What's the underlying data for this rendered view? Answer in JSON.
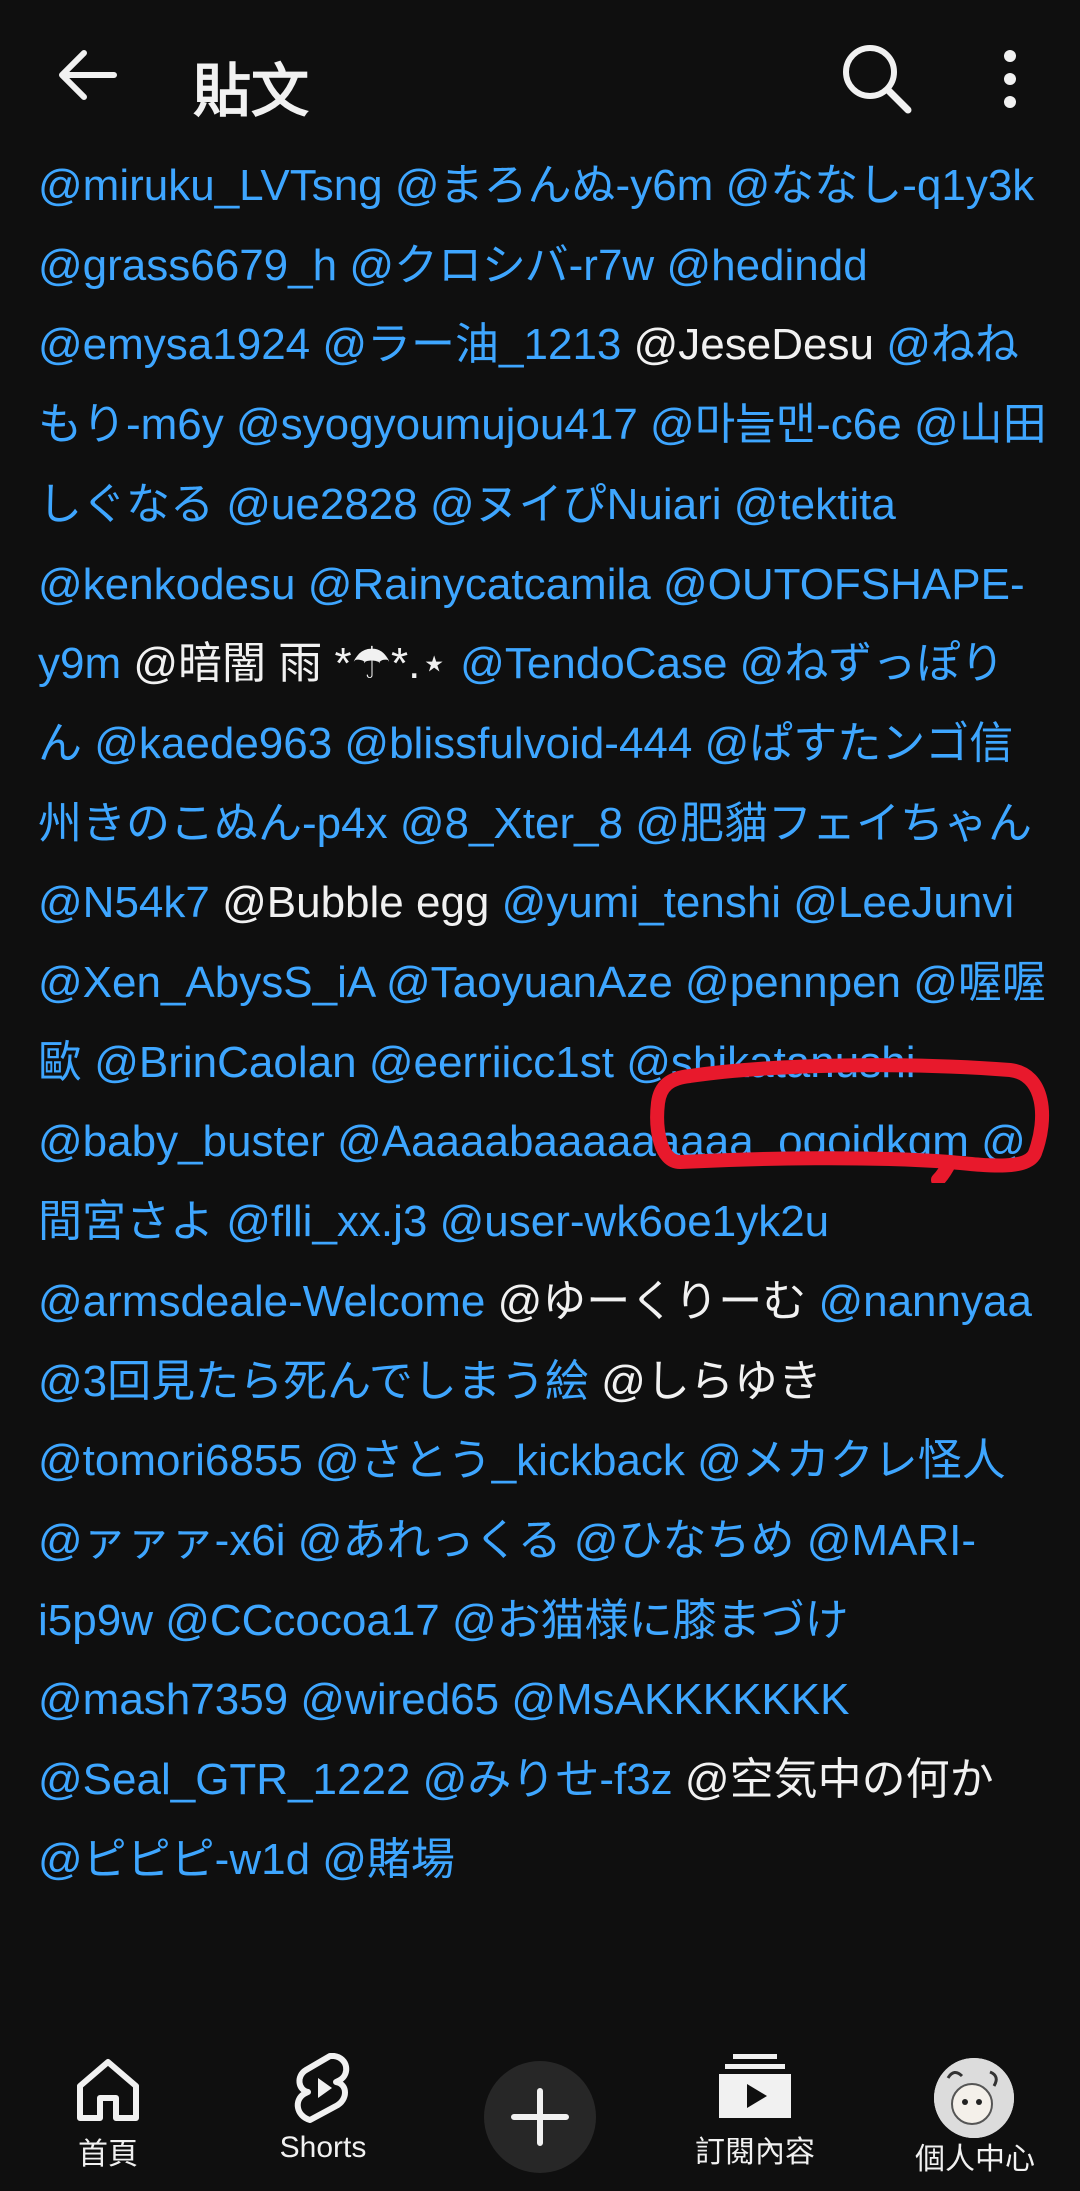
{
  "header": {
    "title": "貼文"
  },
  "mentions": [
    {
      "t": "@miruku_LVTsng ",
      "c": "m"
    },
    {
      "t": "@まろんぬ-y6m ",
      "c": "m"
    },
    {
      "t": "@ななし-q1y3k ",
      "c": "m"
    },
    {
      "t": "@grass6679_h ",
      "c": "m"
    },
    {
      "t": "@クロシバ-r7w ",
      "c": "m"
    },
    {
      "t": "@hedindd ",
      "c": "m"
    },
    {
      "t": "@emysa1924 ",
      "c": "m"
    },
    {
      "t": "@ラー油_1213 ",
      "c": "m"
    },
    {
      "t": "@JeseDesu ",
      "c": "w"
    },
    {
      "t": "@ねねもり-m6y ",
      "c": "m"
    },
    {
      "t": "@syogyoumujou417 ",
      "c": "m"
    },
    {
      "t": "@마늘맨-c6e ",
      "c": "m"
    },
    {
      "t": "@山田しぐなる ",
      "c": "m"
    },
    {
      "t": "@ue2828 ",
      "c": "m"
    },
    {
      "t": "@ヌイぴNuiari ",
      "c": "m"
    },
    {
      "t": "@tektita ",
      "c": "m"
    },
    {
      "t": "@kenkodesu ",
      "c": "m"
    },
    {
      "t": "@Rainycatcamila ",
      "c": "m"
    },
    {
      "t": "@OUTOFSHAPE-y9m ",
      "c": "m"
    },
    {
      "t": "@暗闇 雨 *☂︎*.⋆ ",
      "c": "w"
    },
    {
      "t": "@TendoCase ",
      "c": "m"
    },
    {
      "t": "@ねずっぽりん ",
      "c": "m"
    },
    {
      "t": "@kaede963 ",
      "c": "m"
    },
    {
      "t": "@blissfulvoid-444 ",
      "c": "m"
    },
    {
      "t": "@ぱすたンゴ信州きのこぬん-p4x ",
      "c": "m"
    },
    {
      "t": "@8_Xter_8 ",
      "c": "m"
    },
    {
      "t": "@肥貓フェイちゃん ",
      "c": "m"
    },
    {
      "t": "@N54k7 ",
      "c": "m"
    },
    {
      "t": "@Bubble egg ",
      "c": "w"
    },
    {
      "t": "@yumi_tenshi ",
      "c": "m"
    },
    {
      "t": "@LeeJunvi ",
      "c": "m"
    },
    {
      "t": "@Xen_AbysS_iA ",
      "c": "m"
    },
    {
      "t": "@TaoyuanAze ",
      "c": "m"
    },
    {
      "t": "@pennpen ",
      "c": "m"
    },
    {
      "t": "@喔喔歐 ",
      "c": "m"
    },
    {
      "t": "@BrinCaolan ",
      "c": "m"
    },
    {
      "t": "@eerriicc1st ",
      "c": "m"
    },
    {
      "t": "@shikatanushi ",
      "c": "m"
    },
    {
      "t": "@baby_buster ",
      "c": "m"
    },
    {
      "t": "@Aaaaabaaaaaaaaa_ogoidkgm ",
      "c": "m"
    },
    {
      "t": "@間宮さよ ",
      "c": "m"
    },
    {
      "t": "@flli_xx.j3 ",
      "c": "m"
    },
    {
      "t": "@user-wk6oe1yk2u ",
      "c": "m"
    },
    {
      "t": "@armsdeale-Welcome ",
      "c": "m"
    },
    {
      "t": "@ゆーくりーむ ",
      "c": "w"
    },
    {
      "t": "@nannyaa ",
      "c": "m"
    },
    {
      "t": "@3回見たら死んでしまう絵 ",
      "c": "m"
    },
    {
      "t": "@しらゆき ",
      "c": "w"
    },
    {
      "t": "@tomori6855 ",
      "c": "m"
    },
    {
      "t": "@さとう_kickback ",
      "c": "m"
    },
    {
      "t": "@メカクレ怪人 ",
      "c": "m"
    },
    {
      "t": "@ァァァ-x6i ",
      "c": "m"
    },
    {
      "t": "@あれっくる ",
      "c": "m"
    },
    {
      "t": "@ひなちめ ",
      "c": "m"
    },
    {
      "t": "@MARI-i5p9w ",
      "c": "m"
    },
    {
      "t": "@CCcocoa17 ",
      "c": "m"
    },
    {
      "t": "@お猫様に膝まづけ ",
      "c": "m"
    },
    {
      "t": "@mash7359 ",
      "c": "m"
    },
    {
      "t": "@wired65 ",
      "c": "m"
    },
    {
      "t": "@MsAKKKKKKK ",
      "c": "m"
    },
    {
      "t": "@Seal_GTR_1222 ",
      "c": "m"
    },
    {
      "t": "@みりせ-f3z ",
      "c": "m"
    },
    {
      "t": "@空気中の何か ",
      "c": "w"
    },
    {
      "t": "@ピピピ-w1d ",
      "c": "m"
    },
    {
      "t": "@賭場",
      "c": "m"
    }
  ],
  "nav": {
    "home": "首頁",
    "shorts": "Shorts",
    "subscriptions": "訂閱內容",
    "profile": "個人中心"
  },
  "colors": {
    "mention": "#3ea6ff",
    "highlight_circle": "#e8192c",
    "background": "#0f0f0f"
  }
}
